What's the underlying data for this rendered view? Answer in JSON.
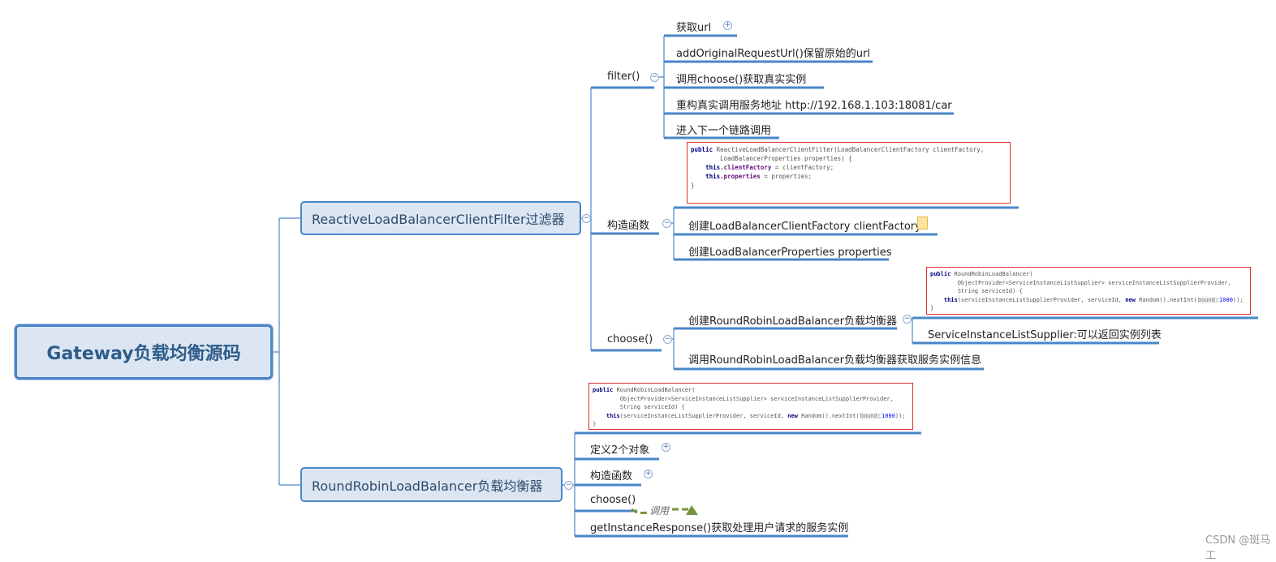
{
  "root": {
    "label": "Gateway负载均衡源码"
  },
  "filter_node": {
    "label": "ReactiveLoadBalancerClientFilter过滤器",
    "filter": {
      "label": "filter()",
      "items": [
        "获取url",
        "addOriginalRequestUrl()保留原始的url",
        "调用choose()获取真实实例",
        "重构真实调用服务地址 http://192.168.1.103:18081/car",
        "进入下一个链路调用"
      ]
    },
    "ctor": {
      "label": "构造函数",
      "code": [
        "public",
        "ReactiveLoadBalancerClientFilter(LoadBalancerClientFactory clientFactory,",
        "        LoadBalancerProperties properties) {",
        "    ",
        "this",
        ".clientFactory",
        " = clientFactory;",
        "this",
        ".properties",
        " = properties;",
        "}"
      ],
      "items": [
        "创建LoadBalancerClientFactory clientFactory",
        "创建LoadBalancerProperties properties"
      ]
    },
    "choose": {
      "label": "choose()",
      "items": [
        "创建RoundRobinLoadBalancer负载均衡器",
        "调用RoundRobinLoadBalancer负载均衡器获取服务实例信息"
      ],
      "sub": "ServiceInstanceListSupplier:可以返回实例列表"
    }
  },
  "rr_node": {
    "label": "RoundRobinLoadBalancer负载均衡器",
    "items": [
      "定义2个对象",
      "构造函数",
      "choose()",
      "getInstanceResponse()获取处理用户请求的服务实例"
    ],
    "call_label": "调用"
  },
  "rr_code": {
    "kw_public": "public",
    "l1": " RoundRobinLoadBalancer(",
    "l2": "        ObjectProvider<ServiceInstanceListSupplier> serviceInstanceListSupplierProvider,",
    "l3": "        String serviceId) {",
    "kw_this": "this",
    "l4a": "(serviceInstanceListSupplierProvider, serviceId, ",
    "kw_new": "new",
    "l4b": " Random().nextInt(",
    "hint": "bound:",
    "num": "1000",
    "l4c": "));",
    "close": "}"
  },
  "watermark": "CSDN @斑马工",
  "colors": {
    "line": "#4a86c8",
    "node_bg": "#dce6f2",
    "code_border": "#e03030",
    "arrow": "#77933c"
  }
}
